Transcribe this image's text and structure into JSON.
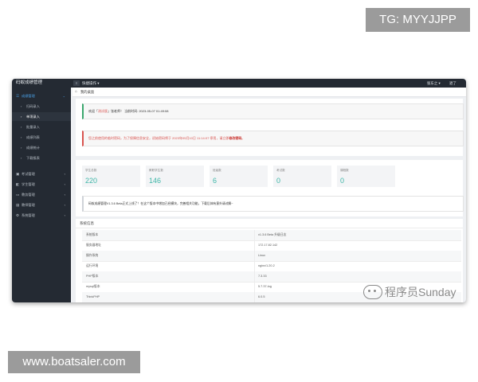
{
  "overlays": {
    "telegram": "TG: MYYJJPP",
    "site": "www.boatsaler.com",
    "watermark": "程序员Sunday"
  },
  "topbar": {
    "app_title": "码蚁成绩管理",
    "menu_toggle": "≡",
    "nav": "快捷操作 ▾",
    "user": "张东之 ▾",
    "exit": "退了"
  },
  "sidebar": {
    "parent": {
      "icon": "☰",
      "label": "成绩管理",
      "chev": "⌄"
    },
    "subitems": [
      {
        "label": "扫码录入"
      },
      {
        "label": "单项录入",
        "active": true
      },
      {
        "label": "批量录入"
      },
      {
        "label": "成绩列表"
      },
      {
        "label": "成绩统计"
      },
      {
        "label": "下载报表"
      }
    ],
    "items": [
      {
        "icon": "▣",
        "label": "考试管理",
        "chev": "‹"
      },
      {
        "icon": "◧",
        "label": "学生管理",
        "chev": "‹"
      },
      {
        "icon": "▭",
        "label": "教务管理",
        "chev": "‹"
      },
      {
        "icon": "▤",
        "label": "教师管理",
        "chev": "‹"
      },
      {
        "icon": "⚙",
        "label": "系统管理",
        "chev": "‹"
      }
    ]
  },
  "breadcrumb": {
    "icon": "⌂",
    "text": "我的桌面"
  },
  "welcome": {
    "pre": "欢迎「",
    "name": "测试版",
    "post": "」张老师！ 当前时间: 2023-05-07 01:49:08"
  },
  "security": {
    "text": "您之前使用的临时密码，为了保障信息安全，初始密码将于 2023年05月10日 11:14:07 停用，请立即",
    "link": "修改密码",
    "end": "。"
  },
  "stats": [
    {
      "label": "学生总数",
      "value": "220"
    },
    {
      "label": "教职学生数",
      "value": "146"
    },
    {
      "label": "班级数",
      "value": "6"
    },
    {
      "label": "考试数",
      "value": "0"
    },
    {
      "label": "课程数",
      "value": "0"
    }
  ],
  "notice": "码蚁成绩管理V1.3.6 Beta正式上线了！在这个版本中增加已经模块，完善相关功能，下载后体有意外请谅解~",
  "system": {
    "title": "系统信息",
    "rows": [
      {
        "key": "系统版本",
        "value": "v1.3.6 Beta   升级日志"
      },
      {
        "key": "服务器地址",
        "value": "172.17.82.142"
      },
      {
        "key": "操作系统",
        "value": "Linux"
      },
      {
        "key": "运行环境",
        "value": "nginx/1.20.2"
      },
      {
        "key": "PHP版本",
        "value": "7.3.33"
      },
      {
        "key": "mysql版本",
        "value": "5.7.37-log"
      },
      {
        "key": "ThinkPHP",
        "value": "6.0.5"
      }
    ]
  }
}
